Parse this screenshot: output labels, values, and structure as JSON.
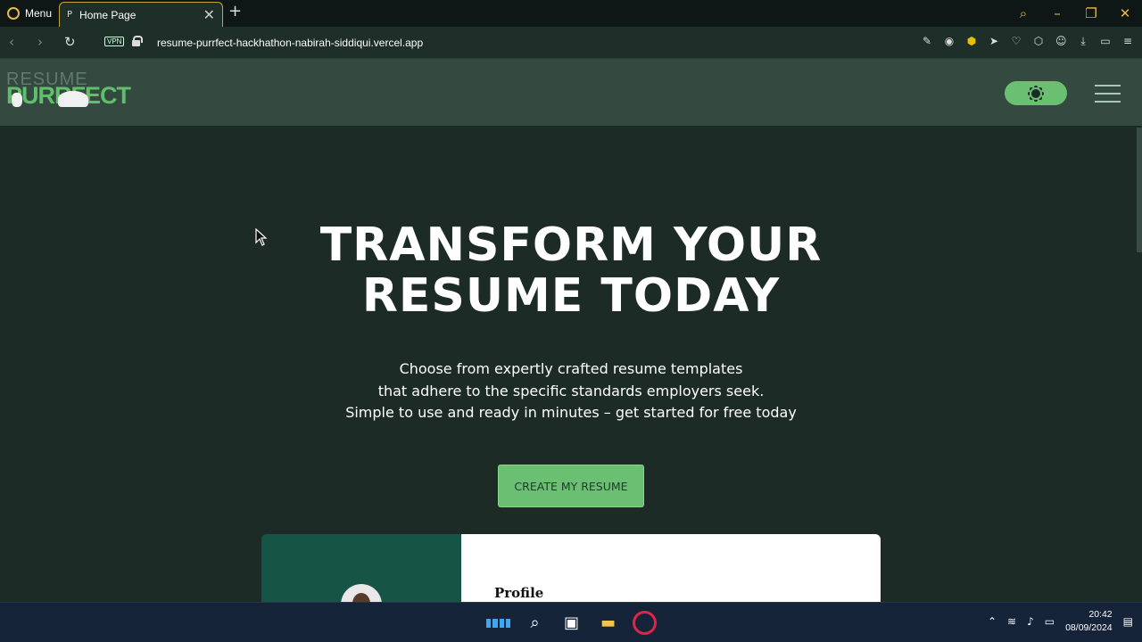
{
  "browser": {
    "menu_label": "Menu",
    "tab_title": "Home Page",
    "tab_favicon": "P",
    "url": "resume-purrfect-hackhathon-nabirah-siddiqui.vercel.app",
    "vpn_label": "VPN"
  },
  "site": {
    "logo_line1": "RESUME",
    "logo_line2": "PURRFECT"
  },
  "hero": {
    "title_line1": "TRANSFORM YOUR",
    "title_line2": "RESUME TODAY",
    "subtitle_line1": "Choose from expertly crafted resume templates",
    "subtitle_line2": "that adhere to the specific standards employers seek.",
    "subtitle_line3": "Simple to use and ready in minutes – get started for free today",
    "cta_label": "CREATE MY RESUME",
    "preview_profile_label": "Profile"
  },
  "taskbar": {
    "time": "20:42",
    "date": "08/09/2024"
  },
  "colors": {
    "accent": "#6abf73",
    "page_bg": "#1c2b25",
    "header_bg": "#34493f"
  }
}
